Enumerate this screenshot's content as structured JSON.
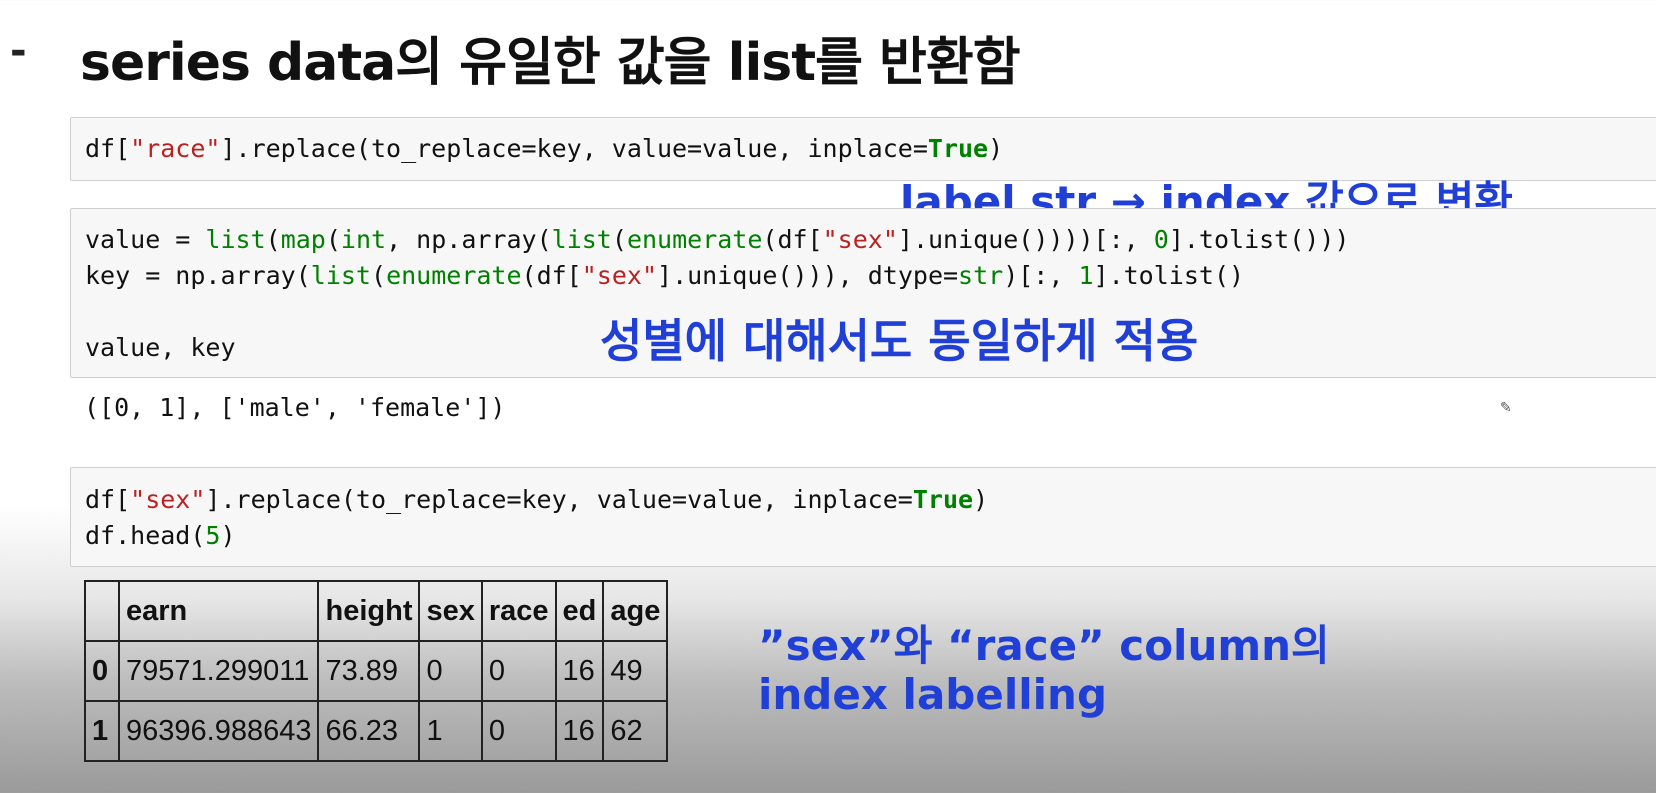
{
  "slide": {
    "dash": "-",
    "title": "series data의 유일한 값을 list를 반환함"
  },
  "cell1": {
    "p1": "df[",
    "s1": "\"race\"",
    "p2": "].replace(to_replace=key, value=value, inplace=",
    "k1": "True",
    "p3": ")"
  },
  "cell2": {
    "l1_a": "value = ",
    "l1_b": "list",
    "l1_c": "(",
    "l1_d": "map",
    "l1_e": "(",
    "l1_f": "int",
    "l1_g": ", np.array(",
    "l1_h": "list",
    "l1_i": "(",
    "l1_j": "enumerate",
    "l1_k": "(df[",
    "l1_l": "\"sex\"",
    "l1_m": "].unique())))[:, ",
    "l1_n": "0",
    "l1_o": "].tolist()))",
    "l2_a": "key = np.array(",
    "l2_b": "list",
    "l2_c": "(",
    "l2_d": "enumerate",
    "l2_e": "(df[",
    "l2_f": "\"sex\"",
    "l2_g": "].unique())), dtype=",
    "l2_h": "str",
    "l2_i": ")[:, ",
    "l2_j": "1",
    "l2_k": "].tolist()",
    "l3": "value, key"
  },
  "output1": "([0, 1], ['male', 'female'])",
  "cell3": {
    "l1_a": "df[",
    "l1_b": "\"sex\"",
    "l1_c": "].replace(to_replace=key, value=value, inplace=",
    "l1_d": "True",
    "l1_e": ")",
    "l2_a": "df.head(",
    "l2_b": "5",
    "l2_c": ")"
  },
  "annotations": {
    "a1": "label str → index 값으로 변환",
    "a2": "성별에 대해서도 동일하게 적용",
    "a3_line1": "”sex”와 “race” column의",
    "a3_line2": "index labelling"
  },
  "table": {
    "headers": [
      "",
      "earn",
      "height",
      "sex",
      "race",
      "ed",
      "age"
    ],
    "rows": [
      [
        "0",
        "79571.299011",
        "73.89",
        "0",
        "0",
        "16",
        "49"
      ],
      [
        "1",
        "96396.988643",
        "66.23",
        "1",
        "0",
        "16",
        "62"
      ]
    ]
  }
}
